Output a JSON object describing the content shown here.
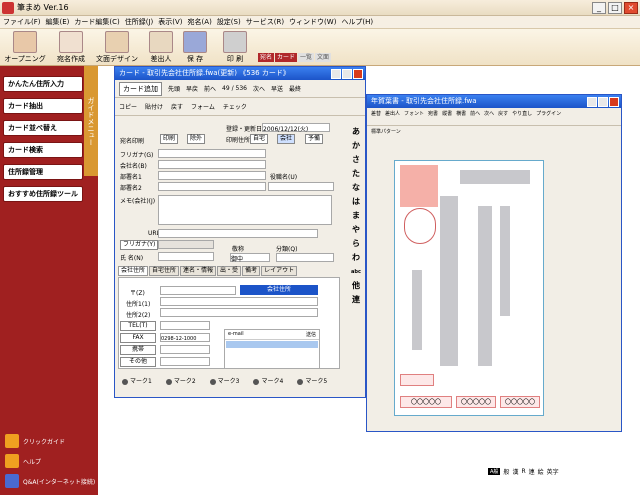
{
  "app": {
    "title": "筆まめ Ver.16"
  },
  "menu": [
    "ファイル(F)",
    "編集(E)",
    "カード編集(C)",
    "住所録(J)",
    "表示(V)",
    "宛名(A)",
    "設定(S)",
    "サービス(R)",
    "ウィンドウ(W)",
    "ヘルプ(H)"
  ],
  "toolbar": {
    "items": [
      {
        "label": "オープニング",
        "color": "#e8c8a8"
      },
      {
        "label": "宛名作成",
        "color": "#f0e0d0"
      },
      {
        "label": "文面デザイン",
        "color": "#e8d0b0"
      },
      {
        "label": "差出人",
        "color": "#e8d8c0"
      },
      {
        "label": "保 存",
        "color": "#9aa8d8"
      },
      {
        "label": "印 刷",
        "color": "#cfcfcf"
      }
    ],
    "modes": [
      "宛名",
      "カード",
      "一覧",
      "文面"
    ]
  },
  "sidebar": {
    "title": "ガイドメニュー",
    "items": [
      "かんたん住所入力",
      "カード抽出",
      "カード並べ替え",
      "カード検索",
      "住所録管理",
      "おすすめ住所録ツール"
    ],
    "links": [
      "クリックガイド",
      "ヘルプ",
      "Q&A(インターネット接続)"
    ]
  },
  "card": {
    "title": "カード - 取引先会社住所録.fwa(更新) 《536 カード》",
    "add_btn": "カード追加",
    "nav": [
      "先頭",
      "早戻",
      "前へ",
      "次へ",
      "早送",
      "最終"
    ],
    "counter": "49 / 536",
    "tb2": [
      "コピー",
      "貼付け",
      "戻す",
      "フォーム",
      "チェック"
    ],
    "reg_label": "登録・更新日",
    "reg_date": "2006/12/12(火)",
    "print_addr_label": "印刷住所",
    "addr_opts": [
      "自宅",
      "会社",
      "予備"
    ],
    "atena_label": "宛名印刷",
    "print_btn": "印刷",
    "exclude_btn": "除外",
    "fields": [
      "フリガナ(G)",
      "会社名(B)",
      "部署名1",
      "部署名2",
      "メモ(会社)(J)",
      "URL",
      "フリガナ(Y)",
      "氏 名(N)"
    ],
    "title_label": "役職名(U)",
    "keisho_label": "敬称",
    "keisho_value": "御中",
    "bunrui_label": "分類(Q)",
    "vchars": [
      "あ",
      "か",
      "さ",
      "た",
      "な",
      "は",
      "ま",
      "や",
      "ら",
      "わ",
      "abc",
      "他",
      "連"
    ],
    "tabs": [
      "会社住所",
      "自宅住所",
      "連名・情報",
      "出・受",
      "備考",
      "レイアウト"
    ],
    "addr_fields": [
      "〒(Z)",
      "住所1(1)",
      "住所2(2)",
      "TEL(T)",
      "FAX",
      "携帯",
      "その他"
    ],
    "company_addr_badge": "会社住所",
    "fax_value": "0298-12-1000",
    "mail_header": "e-mail",
    "send_header": "送信",
    "marks": [
      "マーク1",
      "マーク2",
      "マーク3",
      "マーク4",
      "マーク5"
    ]
  },
  "postcard": {
    "title": "年賀葉書 - 取引先会社住所録.fwa",
    "tb": [
      "差替",
      "差出人",
      "フォント",
      "宛書",
      "縦書",
      "横書",
      "前へ",
      "次へ",
      "戻す",
      "やり直し",
      "プラグイン"
    ],
    "pattern": "標準パターン",
    "postal_boxes": [
      "〇〇〇〇〇",
      "〇〇〇〇〇",
      "〇〇〇〇〇"
    ]
  },
  "status": {
    "ime": "A般",
    "items": [
      "般",
      "漢",
      "R",
      "連",
      "絵",
      "英字"
    ]
  }
}
